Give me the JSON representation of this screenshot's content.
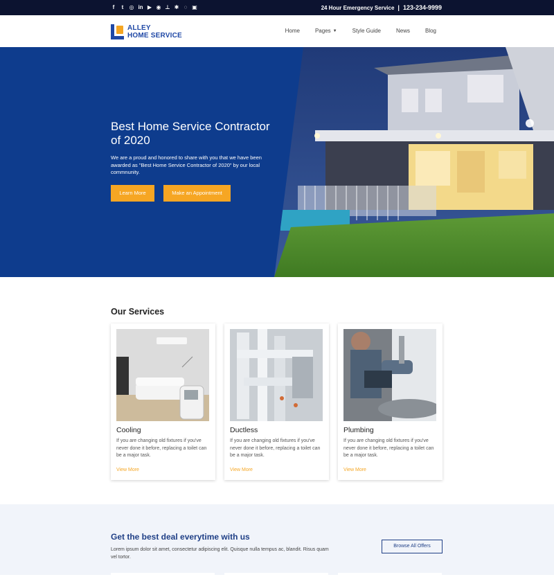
{
  "topbar": {
    "social_icons": [
      "facebook-icon",
      "twitter-icon",
      "instagram-icon",
      "linkedin-icon",
      "youtube-icon",
      "tripadvisor-icon",
      "thumbtack-icon",
      "yelp-icon",
      "chat-icon",
      "houzz-icon"
    ],
    "social_glyphs": [
      "f",
      "t",
      "◎",
      "in",
      "▶",
      "◉",
      "⊥",
      "✱",
      "◌",
      "▣"
    ],
    "emergency_label": "24 Hour Emergency Service",
    "separator": "|",
    "phone": "123-234-9999"
  },
  "header": {
    "logo_line1": "ALLEY",
    "logo_line2": "HOME SERVICE",
    "nav": [
      "Home",
      "Pages",
      "Style Guide",
      "News",
      "Blog"
    ]
  },
  "hero": {
    "title": "Best Home Service Contractor of 2020",
    "text": "We are a proud and honored to share with you that we have been awarded as \"Best Home Service Contractor of 2020\" by our local commnunity.",
    "learn_more": "Learn More",
    "appointment": "Make an Appointment"
  },
  "services": {
    "title": "Our Services",
    "cards": [
      {
        "title": "Cooling",
        "desc": "If you are changing old fixtures if you've never done it before, replacing a toilet can be a major task.",
        "link": "View More"
      },
      {
        "title": "Ductless",
        "desc": "If you are changing old fixtures if you've never done it before, replacing a toilet can be a major task.",
        "link": "View More"
      },
      {
        "title": "Plumbing",
        "desc": "If you are changing old fixtures if you've never done it before, replacing a toilet can be a major task.",
        "link": "View More"
      }
    ]
  },
  "deal": {
    "title": "Get the best deal everytime with us",
    "text": "Lorem ipsum dolor sit amet, consectetur adipiscing elit. Quisque nulla tempus ac, blandit. Risus quam vel tortor.",
    "button": "Browse All Offers"
  },
  "colors": {
    "topbar": "#0c1330",
    "brand_blue": "#1f48a6",
    "hero_blue": "#0e3c8d",
    "accent_orange": "#f6a623",
    "deal_bg": "#f1f4fa"
  }
}
